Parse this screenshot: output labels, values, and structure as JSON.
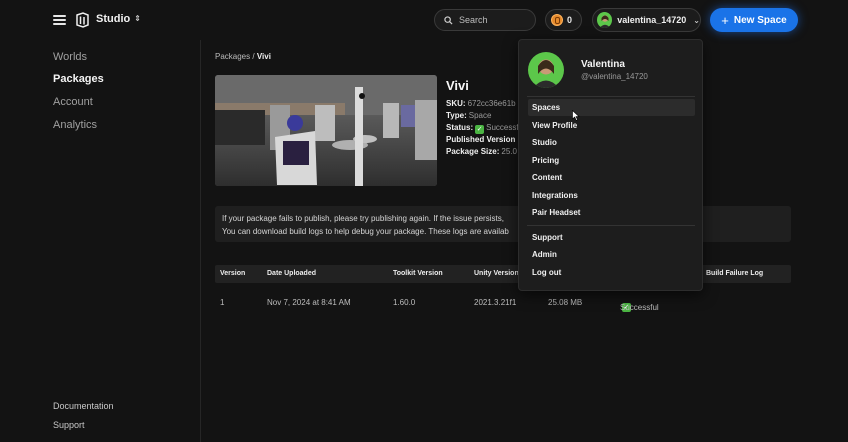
{
  "header": {
    "app_name": "Studio",
    "search_placeholder": "Search",
    "coins": "0",
    "username": "valentina_14720",
    "new_space_label": "New Space",
    "accent": "#1a73e8"
  },
  "sidebar": {
    "items": [
      {
        "label": "Worlds",
        "active": false
      },
      {
        "label": "Packages",
        "active": true
      },
      {
        "label": "Account",
        "active": false
      },
      {
        "label": "Analytics",
        "active": false
      }
    ],
    "footer": [
      "Documentation",
      "Support"
    ]
  },
  "breadcrumb": {
    "parent": "Packages",
    "separator": "/",
    "current": "Vivi"
  },
  "package": {
    "title": "Vivi",
    "sku_label": "SKU:",
    "sku_value": "672cc36e61b",
    "type_label": "Type:",
    "type_value": "Space",
    "status_label": "Status:",
    "status_value": "Successful",
    "published_label": "Published Version",
    "size_label": "Package Size:",
    "size_value": "25.0"
  },
  "notice": {
    "line1": "If your package fails to publish, please try publishing again. If the issue persists,",
    "line2": "You can download build logs to help debug your package. These logs are availab"
  },
  "table": {
    "headers": [
      "Version",
      "Date Uploaded",
      "Toolkit Version",
      "Unity Version",
      "Build Failure Log"
    ],
    "rows": [
      {
        "version": "1",
        "date": "Nov 7, 2024 at 8:41 AM",
        "toolkit": "1.60.0",
        "unity": "2021.3.21f1",
        "size": "25.08 MB",
        "status": "Successful"
      }
    ]
  },
  "dropdown": {
    "name": "Valentina",
    "handle": "@valentina_14720",
    "items": [
      "Spaces",
      "View Profile",
      "Studio",
      "Pricing",
      "Content",
      "Integrations",
      "Pair Headset"
    ],
    "items2": [
      "Support",
      "Admin",
      "Log out"
    ]
  }
}
